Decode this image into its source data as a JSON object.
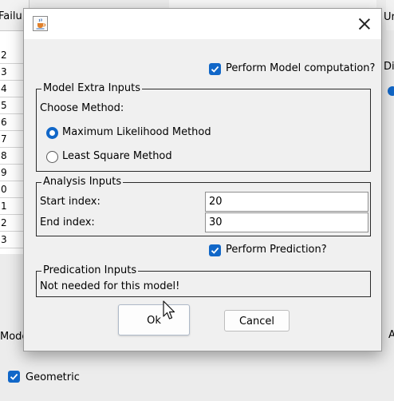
{
  "background": {
    "table_header": "Failu",
    "table_rows": [
      "2",
      "3",
      "4",
      "5",
      "6",
      "7",
      "8",
      "9",
      "0",
      "1",
      "2",
      "3"
    ],
    "right_header": "Ur",
    "right_label": "Di",
    "mode_label": "Mode",
    "right_mode_label": "A",
    "geometric_label": "Geometric",
    "geometric_checked": true
  },
  "dialog": {
    "perform_model": {
      "label": "Perform Model computation?",
      "checked": true
    },
    "model_extra_inputs": {
      "title": "Model Extra Inputs",
      "choose_method_label": "Choose Method:",
      "methods": [
        {
          "label": "Maximum Likelihood Method",
          "selected": true
        },
        {
          "label": "Least Square Method",
          "selected": false
        }
      ]
    },
    "analysis_inputs": {
      "title": "Analysis Inputs",
      "start_label": "Start index:",
      "start_value": "20",
      "end_label": "End index:",
      "end_value": "30"
    },
    "perform_prediction": {
      "label": "Perform Prediction?",
      "checked": true
    },
    "prediction_inputs": {
      "title": "Predication Inputs",
      "message": "Not needed for this model!"
    },
    "buttons": {
      "ok": "Ok",
      "cancel": "Cancel"
    }
  },
  "colors": {
    "accent": "#1167c8",
    "dialog_bg": "#f0f0f0",
    "titlebar_bg": "#ffffff"
  }
}
